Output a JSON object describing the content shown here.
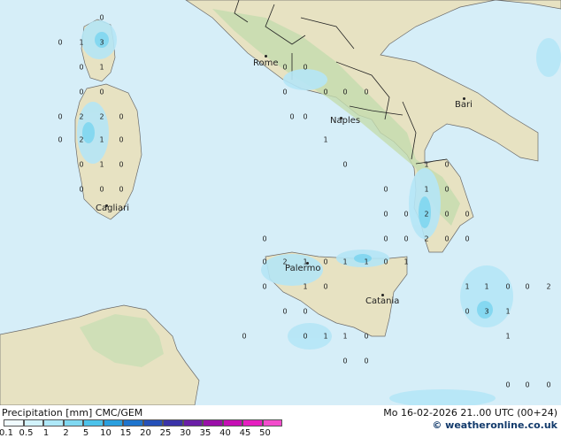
{
  "legend": {
    "title": "Precipitation [mm]",
    "model": "CMC/GEM",
    "ticks": [
      "0.1",
      "0.5",
      "1",
      "2",
      "5",
      "10",
      "15",
      "20",
      "25",
      "30",
      "35",
      "40",
      "45",
      "50"
    ],
    "colors": [
      "#f0fbff",
      "#d2f3fc",
      "#aee8f8",
      "#7fd8f1",
      "#4cc2ea",
      "#2a9fde",
      "#1e74cd",
      "#2550b8",
      "#3a33a8",
      "#6a1fa6",
      "#9a0fa8",
      "#c60fb4",
      "#e61fc0",
      "#f34ccc"
    ]
  },
  "valid_time": "Mo 16-02-2026 21..00 UTC (00+24)",
  "credit": "© weatheronline.co.uk",
  "cities": [
    {
      "name": "Rome"
    },
    {
      "name": "Naples"
    },
    {
      "name": "Bari"
    },
    {
      "name": "Cagliari"
    },
    {
      "name": "Palermo"
    },
    {
      "name": "Catania"
    }
  ],
  "precip_labels": [
    "0",
    "1",
    "3",
    "0",
    "1",
    "0",
    "0",
    "0",
    "2",
    "2",
    "0",
    "0",
    "2",
    "1",
    "0",
    "0",
    "1",
    "0",
    "0",
    "0",
    "0",
    "0",
    "0",
    "0",
    "0",
    "0",
    "0",
    "0",
    "1",
    "0",
    "0",
    "0",
    "1",
    "0",
    "0",
    "1",
    "0",
    "0",
    "0",
    "2",
    "0",
    "0",
    "2",
    "0",
    "0",
    "0",
    "0",
    "2",
    "0",
    "1",
    "0",
    "1",
    "1",
    "0",
    "1",
    "0",
    "0",
    "1",
    "0",
    "0",
    "0",
    "0",
    "1",
    "1",
    "0",
    "1",
    "1",
    "0",
    "0",
    "3",
    "1",
    "0",
    "1",
    "2",
    "0",
    "0",
    "0",
    "0",
    "0",
    "0"
  ],
  "colors": {
    "sea": "#d6eef8",
    "land": "#e9e4c4",
    "land_green": "#c9dfb4",
    "border": "#333333"
  }
}
